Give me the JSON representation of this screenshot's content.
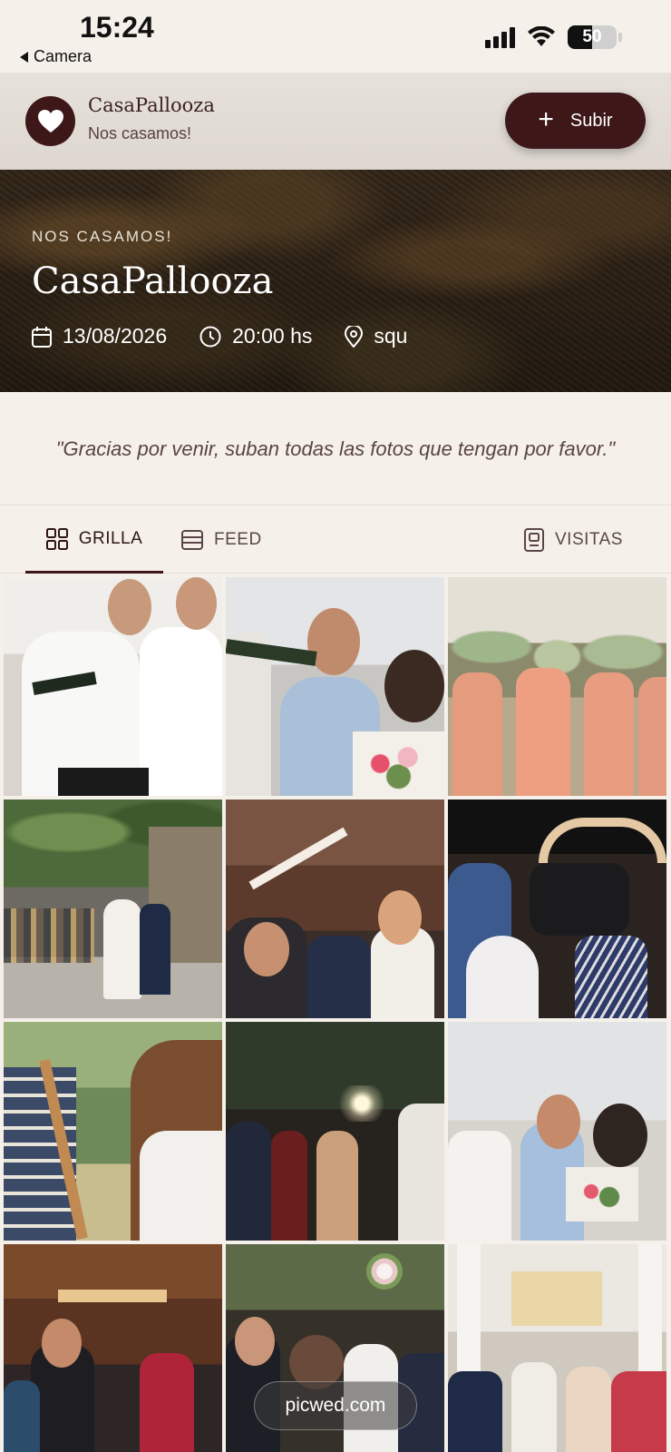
{
  "status_bar": {
    "time": "15:24",
    "back_label": "Camera",
    "battery": "50",
    "battery_level": 0.5
  },
  "header": {
    "brand_name": "CasaPallooza",
    "brand_subtitle": "Nos casamos!",
    "upload_label": "Subir",
    "logo_icon": "heart-icon"
  },
  "hero": {
    "kicker": "NOS CASAMOS!",
    "title": "CasaPallooza",
    "date": "13/08/2026",
    "time": "20:00 hs",
    "location": "squ"
  },
  "quote": "\"Gracias por venir, suban todas las fotos que tengan por favor.\"",
  "tabs": [
    {
      "label": "GRILLA",
      "icon": "grid-icon",
      "active": true
    },
    {
      "label": "FEED",
      "icon": "feed-icon",
      "active": false
    },
    {
      "label": "VISITAS",
      "icon": "guestbook-icon",
      "active": false
    }
  ],
  "watermark": "picwed.com",
  "colors": {
    "brand": "#3e1719",
    "background": "#f5f1ea"
  }
}
